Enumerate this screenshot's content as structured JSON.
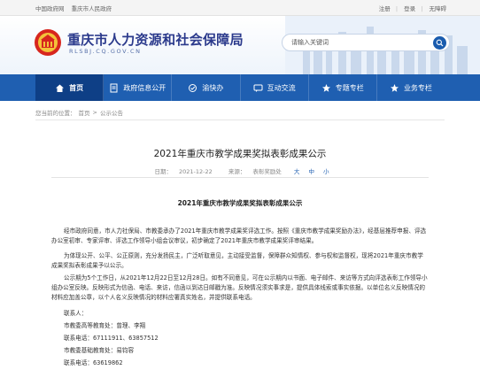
{
  "topbar": {
    "links": [
      "中国政府网",
      "重庆市人民政府"
    ],
    "account": [
      "注册",
      "登录",
      "无障碍"
    ]
  },
  "header": {
    "title": "重庆市人力资源和社会保障局",
    "url": "RLSBJ.CQ.GOV.CN",
    "search_placeholder": "请输入关键词"
  },
  "nav": [
    {
      "label": "首页",
      "icon": "home-icon",
      "active": true
    },
    {
      "label": "政府信息公开",
      "icon": "document-icon",
      "active": false
    },
    {
      "label": "渝快办",
      "icon": "service-icon",
      "active": false
    },
    {
      "label": "互动交流",
      "icon": "chat-icon",
      "active": false
    },
    {
      "label": "专题专栏",
      "icon": "topic-icon",
      "active": false
    },
    {
      "label": "业务专栏",
      "icon": "business-icon",
      "active": false
    }
  ],
  "breadcrumb": {
    "prefix": "您当前的位置：",
    "home": "首页",
    "sep": ">",
    "current": "公示公告"
  },
  "article": {
    "title": "2021年重庆市教学成果奖拟表彰成果公示",
    "date_label": "日期：",
    "date": "2021-12-22",
    "source_label": "来源：",
    "source": "表彰奖励处",
    "font_large": "大",
    "font_medium": "中",
    "font_small": "小",
    "heading": "2021年重庆市教学成果奖拟表彰成果公示",
    "para1": "经市政府同意，市人力社保局、市教委承办了2021年重庆市教学成果奖评选工作。按照《重庆市教学成果奖励办法》，经基层推荐申报、评选办公室初审、专家评审、评选工作领导小组会议审议，初步确定了2021年重庆市教学成果奖评审结果。",
    "para2": "为体现公开、公平、公正原则，充分发扬民主，广泛听取意见，主动接受监督，保障群众知情权、参与权和监督权，现将2021年重庆市教学成果奖拟表彰成果予以公示。",
    "para3": "公示期为5个工作日，从2021年12月22日至12月28日。如有不同意见，可在公示期内以书面、电子邮件、来访等方式向评选表彰工作领导小组办公室反映。反映形式为信函、电话、来访，信函以到达日邮戳为准。反映情况须实事求是，提供具体线索或事实依据。以单位名义反映情况的材料应加盖公章，以个人名义反映情况的材料应署真实姓名，并提供联系电话。",
    "contacts": [
      "联系人：",
      "市教委高等教育处：曾理、李翔",
      "联系电话：67111911、63857512",
      "市教委基础教育处：易钧容",
      "联系电话：63619862"
    ]
  }
}
